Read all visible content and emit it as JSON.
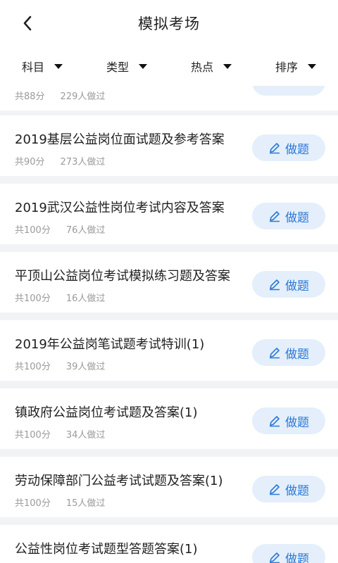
{
  "header": {
    "title": "模拟考场"
  },
  "filters": [
    {
      "label": "科目"
    },
    {
      "label": "类型"
    },
    {
      "label": "热点"
    },
    {
      "label": "排序"
    }
  ],
  "partial_item": {
    "score": "共88分",
    "count": "229人做过"
  },
  "items": [
    {
      "title": "2019基层公益岗位面试题及参考答案",
      "score": "共90分",
      "count": "273人做过",
      "button": "做题"
    },
    {
      "title": "2019武汉公益性岗位考试内容及答案",
      "score": "共100分",
      "count": "76人做过",
      "button": "做题"
    },
    {
      "title": "平顶山公益岗位考试模拟练习题及答案",
      "score": "共100分",
      "count": "16人做过",
      "button": "做题"
    },
    {
      "title": "2019年公益岗笔试题考试特训(1)",
      "score": "共100分",
      "count": "39人做过",
      "button": "做题"
    },
    {
      "title": "镇政府公益岗位考试题及答案(1)",
      "score": "共100分",
      "count": "34人做过",
      "button": "做题"
    },
    {
      "title": "劳动保障部门公益考试试题及答案(1)",
      "score": "共100分",
      "count": "15人做过",
      "button": "做题"
    },
    {
      "title": "公益性岗位考试题型答题答案(1)",
      "score": "",
      "count": "",
      "button": "做题"
    }
  ],
  "colors": {
    "accent": "#2b78d6",
    "button_bg": "#e4effb",
    "page_bg": "#f2f3f5"
  },
  "icons": {
    "back": "chevron-left-icon",
    "edit": "pencil-icon"
  }
}
